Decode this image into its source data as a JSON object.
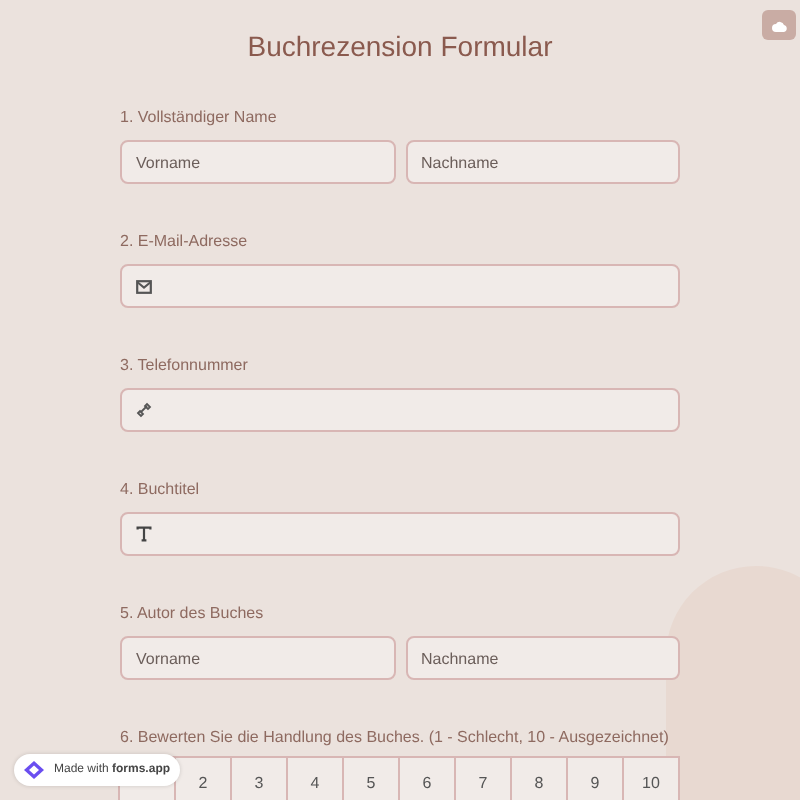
{
  "title": "Buchrezension Formular",
  "questions": [
    {
      "kind": "name",
      "label": "1. Vollständiger Name",
      "fields": [
        {
          "placeholder": "Vorname"
        },
        {
          "placeholder": "Nachname"
        }
      ]
    },
    {
      "kind": "email",
      "label": "2. E-Mail-Adresse"
    },
    {
      "kind": "phone",
      "label": "3. Telefonnummer"
    },
    {
      "kind": "text",
      "label": "4. Buchtitel"
    },
    {
      "kind": "name",
      "label": "5. Autor des Buches",
      "fields": [
        {
          "placeholder": "Vorname"
        },
        {
          "placeholder": "Nachname"
        }
      ]
    },
    {
      "kind": "scale",
      "label": "6. Bewerten Sie die Handlung des Buches. (1 - Schlecht, 10 - Ausgezeichnet)",
      "options": [
        "2",
        "3",
        "4",
        "5",
        "6",
        "7",
        "8",
        "9",
        "10"
      ]
    }
  ],
  "badge": "Made with **forms.app**"
}
